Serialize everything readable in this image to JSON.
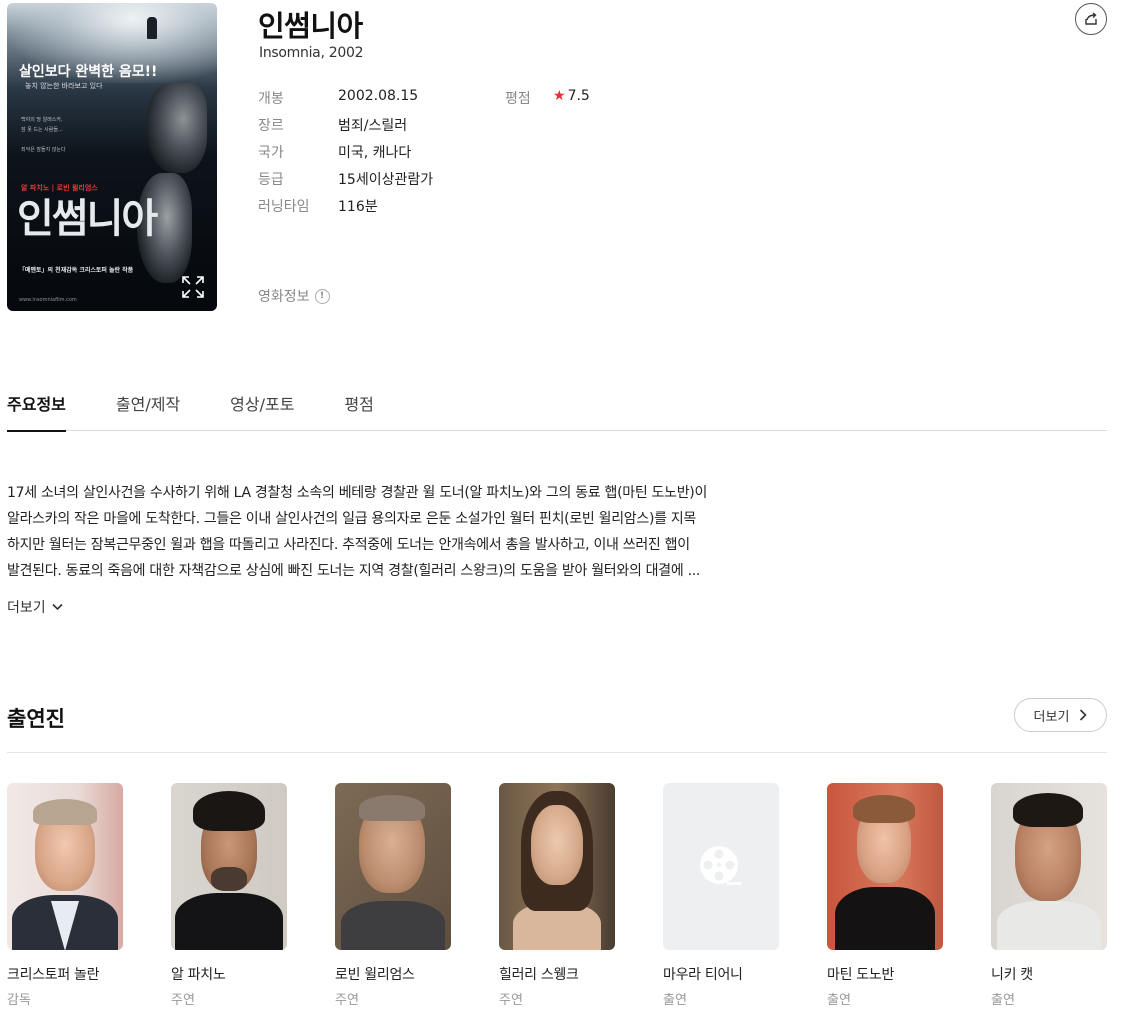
{
  "movie": {
    "title": "인썸니아",
    "subtitle": "Insomnia, 2002",
    "info": [
      {
        "label": "개봉",
        "value": "2002.08.15"
      },
      {
        "label": "장르",
        "value": "범죄/스릴러"
      },
      {
        "label": "국가",
        "value": "미국, 캐나다"
      },
      {
        "label": "등급",
        "value": "15세이상관람가"
      },
      {
        "label": "러닝타임",
        "value": "116분"
      }
    ],
    "rating_label": "평점",
    "rating_value": "7.5",
    "movie_info_label": "영화정보"
  },
  "poster": {
    "tagline": "살인보다 완벽한 음모!!",
    "subtag": "놓치 않는한 바라보고 있다",
    "text_lines": [
      "백야의 땅 알래스카,",
      "잠 못 드는 사람들..."
    ],
    "text_line3": "죄악은 잠들지 않는다",
    "cast": "알 파치노 | 로빈 윌리엄스",
    "big_title": "인썸니아",
    "bottom_text": "「메멘토」의 천재감독 크리스토퍼 놀란 작품",
    "url": "www.insomniafilm.com"
  },
  "tabs": [
    "주요정보",
    "출연/제작",
    "영상/포토",
    "평점"
  ],
  "synopsis": {
    "lines": [
      "17세 소녀의 살인사건을 수사하기 위해 LA 경찰청 소속의 베테랑 경찰관 윌 도너(알 파치노)와 그의 동료 햅(마틴 도노반)이",
      "알라스카의 작은 마을에 도착한다. 그들은 이내 살인사건의 일급 용의자로 은둔 소설가인 월터 핀치(로빈 윌리암스)를 지목",
      "하지만 월터는 잠복근무중인 윌과 햅을 따돌리고 사라진다. 추적중에 도너는 안개속에서 총을 발사하고, 이내 쓰러진 햅이",
      "발견된다. 동료의 죽음에 대한 자책감으로 상심에 빠진 도너는 지역 경찰(힐러리 스왕크)의 도움을 받아 월터와의 대결에 ..."
    ],
    "more_label": "더보기"
  },
  "cast_section": {
    "heading": "출연진",
    "more_label": "더보기",
    "people": [
      {
        "name": "크리스토퍼 놀란",
        "role": "감독"
      },
      {
        "name": "알 파치노",
        "role": "주연"
      },
      {
        "name": "로빈 윌리엄스",
        "role": "주연"
      },
      {
        "name": "힐러리 스웽크",
        "role": "주연"
      },
      {
        "name": "마우라 티어니",
        "role": "출연"
      },
      {
        "name": "마틴 도노반",
        "role": "출연"
      },
      {
        "name": "니키 캣",
        "role": "출연"
      }
    ]
  },
  "colors": {
    "star": "#e8312f",
    "placeholder_bg": "#eeeff1"
  }
}
